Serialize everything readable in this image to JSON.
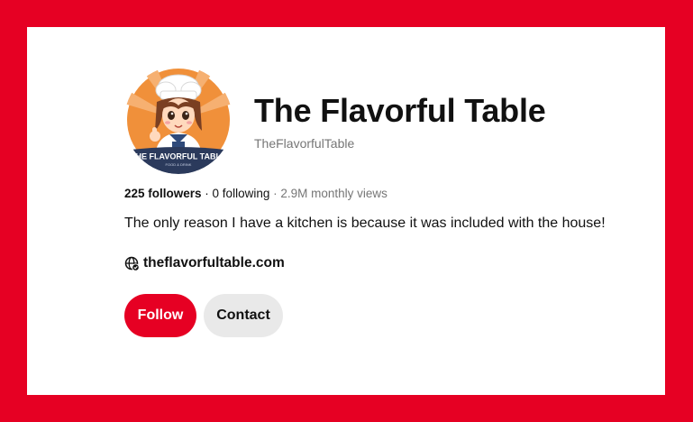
{
  "profile": {
    "name": "The Flavorful Table",
    "handle": "TheFlavorfulTable",
    "avatar_text": "THE FLAVORFUL TABLE",
    "avatar_subtext": "FOOD & DRINK",
    "stats": {
      "followers": "225 followers",
      "sep1": " · ",
      "following": "0 following",
      "sep2": " · ",
      "monthly_views": "2.9M monthly views"
    },
    "bio": "The only reason I have a kitchen is because it was included with the house!",
    "website": "theflavorfultable.com",
    "website_icon": "globe-verified-icon"
  },
  "actions": {
    "follow_label": "Follow",
    "contact_label": "Contact"
  },
  "colors": {
    "brand_red": "#e60023",
    "text_primary": "#111111",
    "text_secondary": "#767676",
    "button_secondary_bg": "#e9e9e9",
    "avatar_bg_orange": "#f0903a",
    "avatar_banner_navy": "#2b3a5c"
  }
}
